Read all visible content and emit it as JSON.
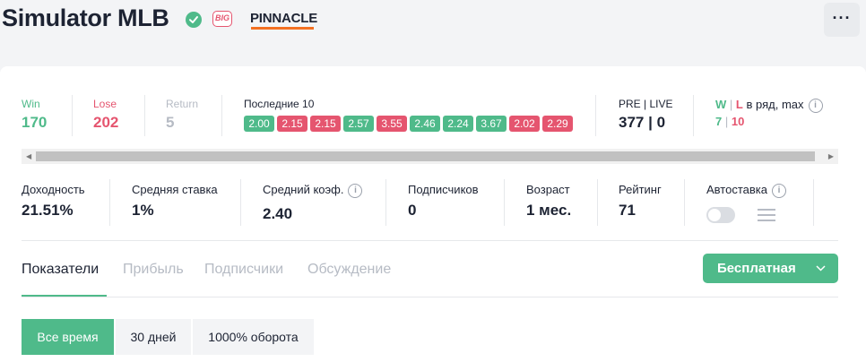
{
  "header": {
    "title": "Simulator MLB",
    "badge_big": "BIG",
    "bookmaker": "PINNACLE",
    "more_label": "···"
  },
  "stats": {
    "win": {
      "label": "Win",
      "value": "170"
    },
    "lose": {
      "label": "Lose",
      "value": "202"
    },
    "return": {
      "label": "Return",
      "value": "5"
    },
    "last10": {
      "label": "Последние 10",
      "results": [
        {
          "value": "2.00",
          "outcome": "win"
        },
        {
          "value": "2.15",
          "outcome": "lose"
        },
        {
          "value": "2.15",
          "outcome": "lose"
        },
        {
          "value": "2.57",
          "outcome": "win"
        },
        {
          "value": "3.55",
          "outcome": "lose"
        },
        {
          "value": "2.46",
          "outcome": "win"
        },
        {
          "value": "2.24",
          "outcome": "win"
        },
        {
          "value": "3.67",
          "outcome": "win"
        },
        {
          "value": "2.02",
          "outcome": "lose"
        },
        {
          "value": "2.29",
          "outcome": "lose"
        }
      ]
    },
    "pre_live": {
      "label": "PRE | LIVE",
      "value": "377 | 0"
    },
    "streak": {
      "w": "W",
      "sep": "|",
      "l": "L",
      "label_rest": " в ряд, max",
      "w_value": "7",
      "l_value": "10"
    }
  },
  "metrics": {
    "yield": {
      "label": "Доходность",
      "value": "21.51%"
    },
    "avg_stake": {
      "label": "Средняя ставка",
      "value": "1%"
    },
    "avg_odds": {
      "label": "Средний коэф.",
      "value": "2.40"
    },
    "subscribers": {
      "label": "Подписчиков",
      "value": "0"
    },
    "age": {
      "label": "Возраст",
      "value": "1 мес."
    },
    "rating": {
      "label": "Рейтинг",
      "value": "71"
    },
    "autobet": {
      "label": "Автоставка"
    }
  },
  "tabs": [
    {
      "label": "Показатели",
      "active": true
    },
    {
      "label": "Прибыль",
      "active": false
    },
    {
      "label": "Подписчики",
      "active": false
    },
    {
      "label": "Обсуждение",
      "active": false
    }
  ],
  "plan_button": {
    "label": "Бесплатная"
  },
  "periods": [
    {
      "label": "Все время",
      "active": true
    },
    {
      "label": "30 дней",
      "active": false
    },
    {
      "label": "1000% оборота",
      "active": false
    }
  ],
  "colors": {
    "win": "#4fba8a",
    "lose": "#e5556f",
    "accent": "#4fba8a",
    "bookmaker_accent": "#f37021"
  }
}
